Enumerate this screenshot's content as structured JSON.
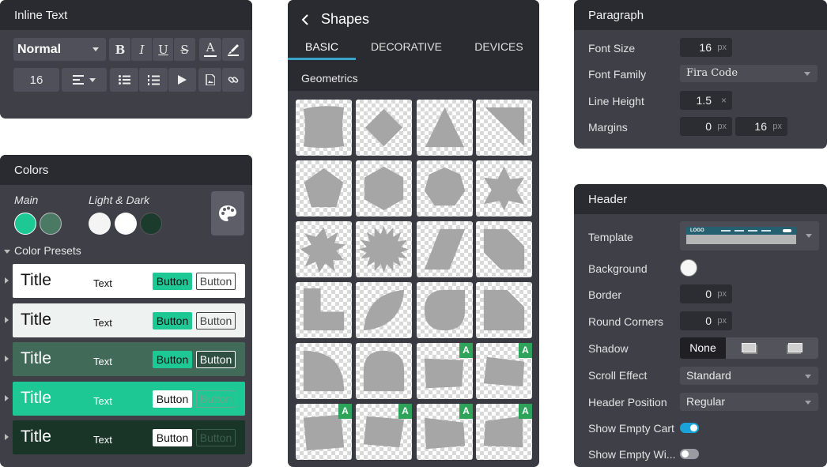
{
  "inline_text": {
    "title": "Inline Text",
    "style_select": "Normal",
    "bold": "B",
    "italic": "I",
    "underline": "U",
    "strike": "S",
    "text_color": "A",
    "font_size": "16"
  },
  "colors": {
    "title": "Colors",
    "main_label": "Main",
    "light_dark_label": "Light & Dark",
    "main_colors": [
      "#1ec894",
      "#4a7a63"
    ],
    "light_dark_colors": [
      "#f4f4f4",
      "#ffffff",
      "#1b3b2c"
    ],
    "presets_label": "Color Presets",
    "presets": [
      {
        "title": "Title",
        "text": "Text",
        "button": "Button",
        "button_outline": "Button",
        "bg": "#ffffff",
        "fg": "#111111",
        "btn_bg": "#1ec894",
        "btn_fg": "#111111",
        "out_color": "#444444"
      },
      {
        "title": "Title",
        "text": "Text",
        "button": "Button",
        "button_outline": "Button",
        "bg": "#eef2f0",
        "fg": "#111111",
        "btn_bg": "#1ec894",
        "btn_fg": "#111111",
        "out_color": "#444444"
      },
      {
        "title": "Title",
        "text": "Text",
        "button": "Button",
        "button_outline": "Button",
        "bg": "#416a58",
        "fg": "#ffffff",
        "btn_bg": "#1ec894",
        "btn_fg": "#111111",
        "out_color": "#ffffff"
      },
      {
        "title": "Title",
        "text": "Text",
        "button": "Button",
        "button_outline": "Button",
        "bg": "#1ec894",
        "fg": "#ffffff",
        "btn_bg": "#ffffff",
        "btn_fg": "#111111",
        "out_color": "#6fa58b"
      },
      {
        "title": "Title",
        "text": "Text",
        "button": "Button",
        "button_outline": "Button",
        "bg": "#193528",
        "fg": "#ffffff",
        "btn_bg": "#ffffff",
        "btn_fg": "#111111",
        "out_color": "#3d5f4f"
      }
    ]
  },
  "shapes": {
    "title": "Shapes",
    "tabs": [
      "BASIC",
      "DECORATIVE",
      "DEVICES"
    ],
    "active_tab": "BASIC",
    "section": "Geometrics",
    "badge": "A",
    "accent": "#3aa4c8",
    "shape_fill": "#a6a6a6"
  },
  "paragraph": {
    "title": "Paragraph",
    "font_size_label": "Font Size",
    "font_size": "16",
    "font_size_unit": "px",
    "font_family_label": "Font Family",
    "font_family": "Fira Code",
    "line_height_label": "Line Height",
    "line_height": "1.5",
    "line_height_unit": "×",
    "margins_label": "Margins",
    "margin_top": "0",
    "margin_top_unit": "px",
    "margin_bottom": "16",
    "margin_bottom_unit": "px"
  },
  "header": {
    "title": "Header",
    "template_label": "Template",
    "template_logo": "LOGO",
    "background_label": "Background",
    "border_label": "Border",
    "border_value": "0",
    "border_unit": "px",
    "round_corners_label": "Round Corners",
    "round_corners_value": "0",
    "round_corners_unit": "px",
    "shadow_label": "Shadow",
    "shadow_options": [
      "None",
      "",
      ""
    ],
    "scroll_effect_label": "Scroll Effect",
    "scroll_effect": "Standard",
    "header_position_label": "Header Position",
    "header_position": "Regular",
    "show_empty_cart_label": "Show Empty Cart",
    "show_empty_cart": true,
    "show_empty_wishlist_label": "Show Empty Wi...",
    "show_empty_wishlist": false,
    "toggle_on_color": "#1aa3d9"
  }
}
